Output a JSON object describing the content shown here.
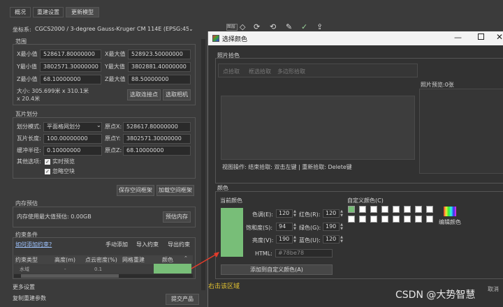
{
  "tabs": [
    "概况",
    "重建设置",
    "更新模型"
  ],
  "crs": {
    "label": "坐标系:",
    "value": "CGCS2000 / 3-degree Gauss-Kruger CM 114E (EPSG:45"
  },
  "range": {
    "title": "范围",
    "xmin_label": "X最小值",
    "xmin": "528617.80000000",
    "xmax_label": "X最大值",
    "xmax": "528923.50000000",
    "ymin_label": "Y最小值",
    "ymin": "3802571.30000000",
    "ymax_label": "Y最大值",
    "ymax": "3802881.40000000",
    "zmin_label": "Z最小值",
    "zmin": "68.10000000",
    "zmax_label": "Z最大值",
    "zmax": "88.50000000",
    "size_text": "大小: 305.699米 x 310.1米 x 20.4米",
    "pick_points_btn": "选取连接点",
    "pick_camera_btn": "选取相机"
  },
  "tiles": {
    "title": "瓦片划分",
    "mode_label": "划分模式:",
    "mode_value": "平面格网划分",
    "len_label": "瓦片长度:",
    "len_value": "100.00000000",
    "buf_label": "缓冲半径:",
    "buf_value": "0.10000000",
    "origin_x_label": "原点X:",
    "origin_x": "528617.80000000",
    "origin_y_label": "原点Y:",
    "origin_y": "3802571.30000000",
    "origin_z_label": "原点Z:",
    "origin_z": "68.10000000",
    "other_label": "其他选项:",
    "opt1": "实时预览",
    "opt2": "忽略空块",
    "save_btn": "保存空间框架",
    "load_btn": "加载空间框架"
  },
  "memory": {
    "title": "内存预估",
    "text": "内存使用最大值预估: 0.00GB",
    "btn": "预估内存"
  },
  "constraints": {
    "title": "约束条件",
    "link": "如何添加约束?",
    "add_manual": "手动添加",
    "import": "导入约束",
    "export": "导出约束",
    "columns": [
      "约束类型",
      "高度(m)",
      "点云密度(%)",
      "网格重建",
      "颜色"
    ],
    "row": [
      "水域",
      "-",
      "0.1 ",
      "",
      ""
    ]
  },
  "more_settings": "更多设置",
  "copy_params": "复制重建参数",
  "submit": "提交产品",
  "toolbar_dropdown": "图层",
  "dialog": {
    "title": "选择颜色",
    "pick_section": "照片拾色",
    "pick_tabs": [
      "点拾取",
      "框选拾取",
      "多边形拾取"
    ],
    "preview_label": "照片预览:0张",
    "hint": "视图操作: 结束拾取: 双击左键 | 重新拾取: Delete键",
    "color_section": "颜色",
    "current_color": "当前颜色",
    "custom_colors": "自定义颜色(C)",
    "edit_colors": "编辑颜色",
    "hue_label": "色调(E):",
    "hue": "120",
    "sat_label": "饱和度(S):",
    "sat": "94",
    "val_label": "亮度(V):",
    "val": "190",
    "red_label": "红色(R):",
    "red": "120",
    "green_label": "绿色(G):",
    "green": "190",
    "blue_label": "蓝色(U):",
    "blue": "120",
    "html_label": "HTML:",
    "html": "#78be78",
    "add_custom": "添加到自定义颜色(A)",
    "current_hex": "#78be78",
    "cancel": "取消"
  },
  "annotation": "右击该区域",
  "watermark": "CSDN @大势智慧"
}
